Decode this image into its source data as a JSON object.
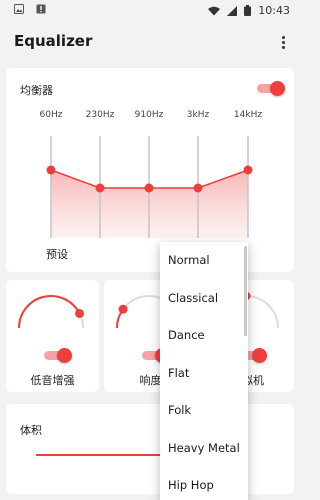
{
  "status_bar": {
    "time": "10:43"
  },
  "app_bar": {
    "title": "Equalizer"
  },
  "equalizer": {
    "label": "均衡器",
    "enabled": true,
    "bands": [
      "60Hz",
      "230Hz",
      "910Hz",
      "3kHz",
      "14kHz"
    ],
    "levels": [
      0.0,
      -0.6,
      -0.6,
      -0.6,
      0.0
    ],
    "preset_label": "预设",
    "accent_color": "#ee3e3e"
  },
  "effects": [
    {
      "label": "低音增强",
      "enabled": true,
      "level": 0.85
    },
    {
      "label": "响度",
      "enabled": true,
      "level": 0.2
    },
    {
      "label": "虚拟机",
      "enabled": true,
      "level": 0.5
    }
  ],
  "volume": {
    "label": "体积"
  },
  "preset_dropdown": {
    "options": [
      "Normal",
      "Classical",
      "Dance",
      "Flat",
      "Folk",
      "Heavy Metal",
      "Hip Hop"
    ]
  }
}
